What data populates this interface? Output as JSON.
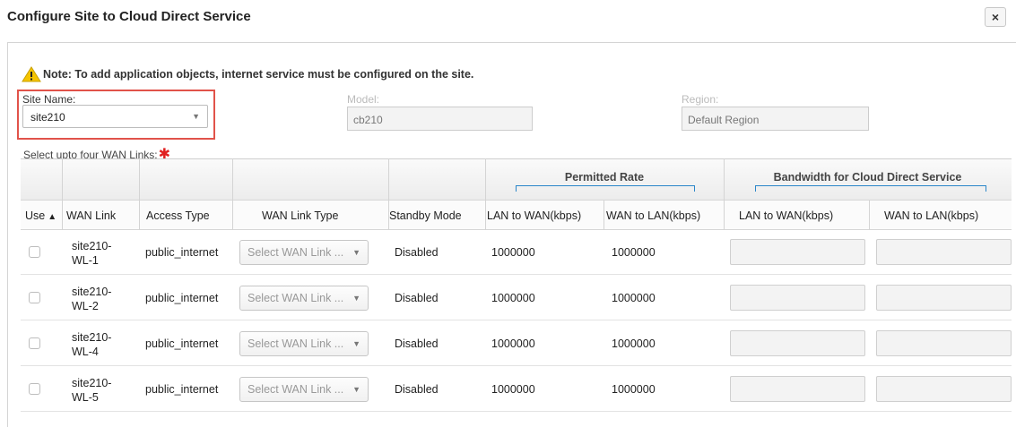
{
  "dialog": {
    "title": "Configure Site to Cloud Direct Service",
    "close_label": "×"
  },
  "note": "Note: To add application objects, internet service must be configured on the site.",
  "site": {
    "label": "Site Name:",
    "value": "site210"
  },
  "model": {
    "label": "Model:",
    "value": "cb210"
  },
  "region": {
    "label": "Region:",
    "value": "Default Region"
  },
  "wan_links": {
    "label": "Select upto four WAN Links:",
    "required_marker": "✱"
  },
  "table": {
    "groups": {
      "permitted_rate": "Permitted Rate",
      "bandwidth": "Bandwidth for Cloud Direct Service"
    },
    "columns": {
      "use": "Use",
      "wan_link": "WAN Link",
      "access_type": "Access Type",
      "wan_link_type": "WAN Link Type",
      "standby_mode": "Standby Mode",
      "lan_to_wan": "LAN to WAN(kbps)",
      "wan_to_lan": "WAN to LAN(kbps)",
      "bw_lan_to_wan": "LAN to WAN(kbps)",
      "bw_wan_to_lan": "WAN to LAN(kbps)"
    },
    "rows": [
      {
        "wan_link_line1": "site210-",
        "wan_link_line2": "WL-1",
        "access_type": "public_internet",
        "wan_link_type": "Select WAN Link ...",
        "standby_mode": "Disabled",
        "lan_to_wan": "1000000",
        "wan_to_lan": "1000000",
        "checked": false
      },
      {
        "wan_link_line1": "site210-",
        "wan_link_line2": "WL-2",
        "access_type": "public_internet",
        "wan_link_type": "Select WAN Link ...",
        "standby_mode": "Disabled",
        "lan_to_wan": "1000000",
        "wan_to_lan": "1000000",
        "checked": false
      },
      {
        "wan_link_line1": "site210-",
        "wan_link_line2": "WL-4",
        "access_type": "public_internet",
        "wan_link_type": "Select WAN Link ...",
        "standby_mode": "Disabled",
        "lan_to_wan": "1000000",
        "wan_to_lan": "1000000",
        "checked": false
      },
      {
        "wan_link_line1": "site210-",
        "wan_link_line2": "WL-5",
        "access_type": "public_internet",
        "wan_link_type": "Select WAN Link ...",
        "standby_mode": "Disabled",
        "lan_to_wan": "1000000",
        "wan_to_lan": "1000000",
        "checked": false
      }
    ]
  },
  "colors": {
    "highlight": "#e1534a",
    "bracket": "#2a86c9",
    "required": "#e02020",
    "warning": "#f5c400"
  },
  "icons": {
    "warning": "warning-icon",
    "close": "close-icon",
    "sort": "sort-ascending-icon",
    "dropdown": "chevron-down-icon"
  }
}
